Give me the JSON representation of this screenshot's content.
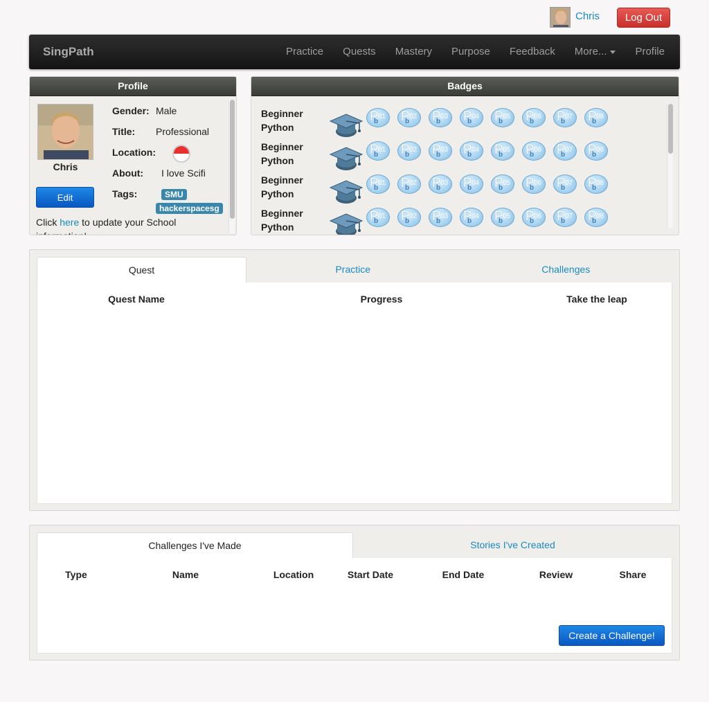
{
  "user": {
    "name": "Chris",
    "logout_label": "Log Out"
  },
  "navbar": {
    "brand": "SingPath",
    "items": [
      "Practice",
      "Quests",
      "Mastery",
      "Purpose",
      "Feedback",
      "More...",
      "Profile"
    ]
  },
  "profile": {
    "title": "Profile",
    "name": "Chris",
    "edit_label": "Edit",
    "gender_label": "Gender:",
    "gender": "Male",
    "title_label": "Title:",
    "title_value": "Professional",
    "location_label": "Location:",
    "about_label": "About:",
    "about": "I love Scifi",
    "tags_label": "Tags:",
    "tags": [
      "SMU",
      "hackerspacesg"
    ],
    "school_note_pre": "Click ",
    "school_note_link": "here",
    "school_note_post": " to update your School information!"
  },
  "badges": {
    "title": "Badges",
    "rows": [
      {
        "label": "Beginner Python",
        "numbers": [
          "01",
          "02",
          "03",
          "04",
          "05",
          "06",
          "07",
          "08"
        ]
      },
      {
        "label": "Beginner Python",
        "numbers": [
          "01",
          "02",
          "03",
          "04",
          "05",
          "06",
          "07",
          "08"
        ]
      },
      {
        "label": "Beginner Python",
        "numbers": [
          "01",
          "02",
          "03",
          "04",
          "05",
          "06",
          "07",
          "08"
        ]
      },
      {
        "label": "Beginner Python",
        "numbers": [
          "01",
          "02",
          "03",
          "04",
          "05",
          "06",
          "07",
          "08"
        ]
      }
    ]
  },
  "quest_panel": {
    "tabs": [
      "Quest",
      "Practice",
      "Challenges"
    ],
    "active_tab": 0,
    "columns": [
      "Quest Name",
      "Progress",
      "Take the leap"
    ]
  },
  "challenges_panel": {
    "tabs": [
      "Challenges I've Made",
      "Stories I've Created"
    ],
    "active_tab": 0,
    "columns": [
      "Type",
      "Name",
      "Location",
      "Start Date",
      "End Date",
      "Review",
      "Share"
    ],
    "create_label": "Create a Challenge!"
  },
  "colors": {
    "link": "#1a8ac0",
    "primary": "#0a57c2",
    "danger": "#c9302c",
    "tag": "#3a87ad"
  }
}
